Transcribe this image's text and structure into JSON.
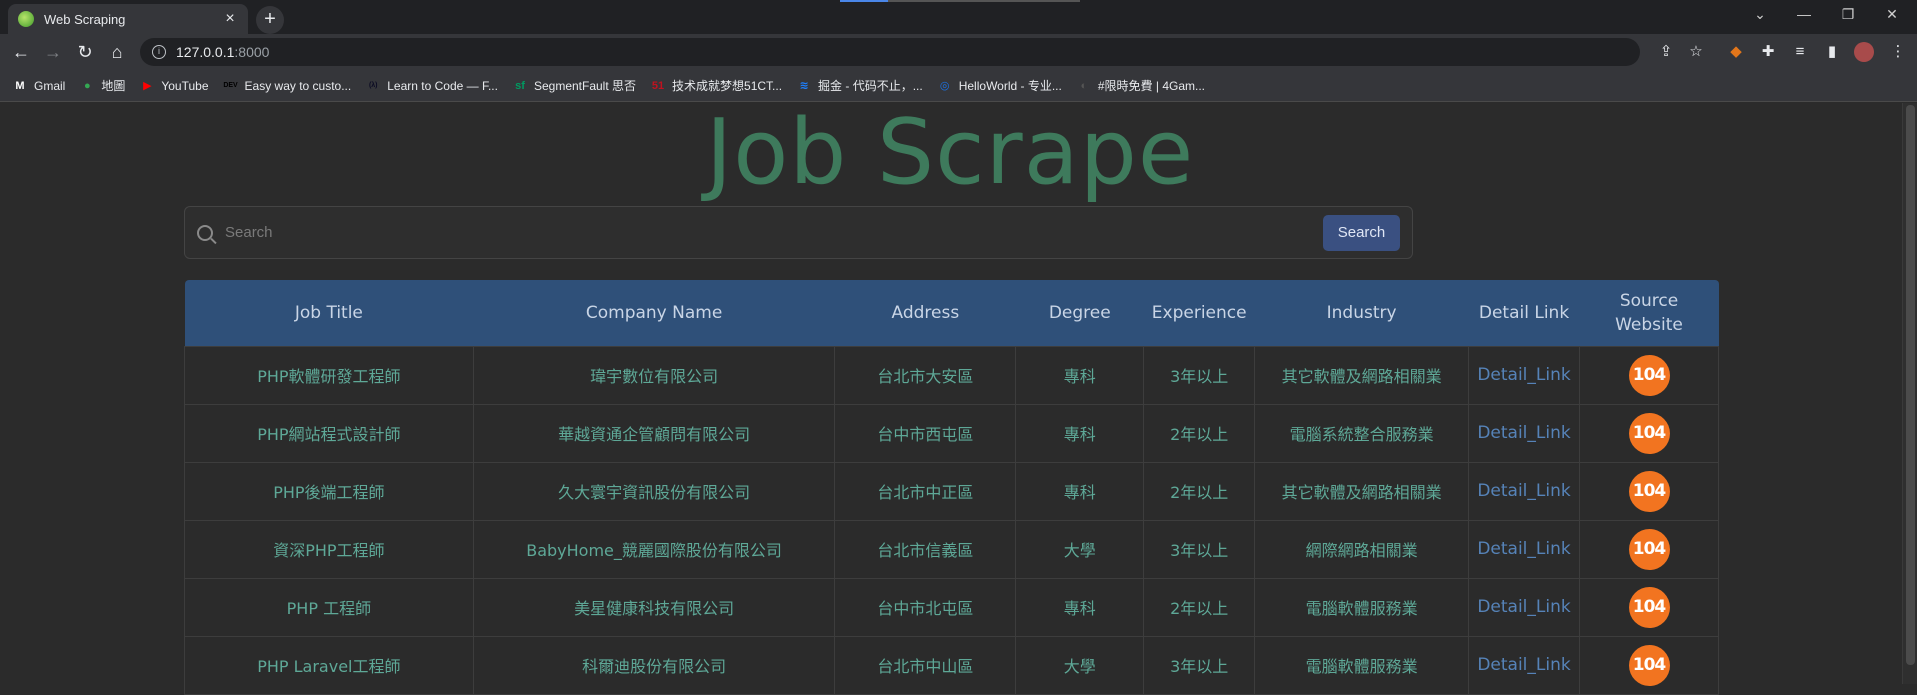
{
  "browser": {
    "tab_title": "Web Scraping",
    "tab_close": "×",
    "new_tab": "+",
    "url_host": "127.0.0.1",
    "url_port": ":8000",
    "bookmarks": [
      {
        "label": "Gmail",
        "icon": "M",
        "color": "#ffffff"
      },
      {
        "label": "地圖",
        "icon": "●",
        "color": "#34a853"
      },
      {
        "label": "YouTube",
        "icon": "▶",
        "color": "#ff0000"
      },
      {
        "label": "Easy way to custo...",
        "icon": "DEV",
        "color": "#000000"
      },
      {
        "label": "Learn to Code — F...",
        "icon": "(λ)",
        "color": "#0a0a23"
      },
      {
        "label": "SegmentFault 思否",
        "icon": "sf",
        "color": "#009a61"
      },
      {
        "label": "技术成就梦想51CT...",
        "icon": "51",
        "color": "#c1121f"
      },
      {
        "label": "掘金 - 代码不止，...",
        "icon": "≋",
        "color": "#1e80ff"
      },
      {
        "label": "HelloWorld - 专业...",
        "icon": "◎",
        "color": "#1a73e8"
      },
      {
        "label": "#限時免費 | 4Gam...",
        "icon": "◐",
        "color": "#555555"
      }
    ]
  },
  "page": {
    "title": "Job Scrape",
    "search": {
      "placeholder": "Search",
      "button_label": "Search"
    },
    "table": {
      "headers": [
        "Job Title",
        "Company Name",
        "Address",
        "Degree",
        "Experience",
        "Industry",
        "Detail Link",
        "Source Website"
      ],
      "rows": [
        {
          "job_title": "PHP軟體研發工程師",
          "company": "瑋宇數位有限公司",
          "address": "台北市大安區",
          "degree": "專科",
          "experience": "3年以上",
          "industry": "其它軟體及網路相關業",
          "link": "Detail_Link",
          "source": "104"
        },
        {
          "job_title": "PHP網站程式設計師",
          "company": "華越資通企管顧問有限公司",
          "address": "台中市西屯區",
          "degree": "專科",
          "experience": "2年以上",
          "industry": "電腦系統整合服務業",
          "link": "Detail_Link",
          "source": "104"
        },
        {
          "job_title": "PHP後端工程師",
          "company": "久大寰宇資訊股份有限公司",
          "address": "台北市中正區",
          "degree": "專科",
          "experience": "2年以上",
          "industry": "其它軟體及網路相關業",
          "link": "Detail_Link",
          "source": "104"
        },
        {
          "job_title": "資深PHP工程師",
          "company": "BabyHome_競麗國際股份有限公司",
          "address": "台北市信義區",
          "degree": "大學",
          "experience": "3年以上",
          "industry": "網際網路相關業",
          "link": "Detail_Link",
          "source": "104"
        },
        {
          "job_title": "PHP 工程師",
          "company": "美星健康科技有限公司",
          "address": "台中市北屯區",
          "degree": "專科",
          "experience": "2年以上",
          "industry": "電腦軟體服務業",
          "link": "Detail_Link",
          "source": "104"
        },
        {
          "job_title": "PHP Laravel工程師",
          "company": "科爾迪股份有限公司",
          "address": "台北市中山區",
          "degree": "大學",
          "experience": "3年以上",
          "industry": "電腦軟體服務業",
          "link": "Detail_Link",
          "source": "104"
        }
      ]
    }
  },
  "colors": {
    "title": "#3e7a5c",
    "header_bg": "#2f5079",
    "cell_text": "#5ea897",
    "link": "#5683b8",
    "badge": "#f27420"
  }
}
